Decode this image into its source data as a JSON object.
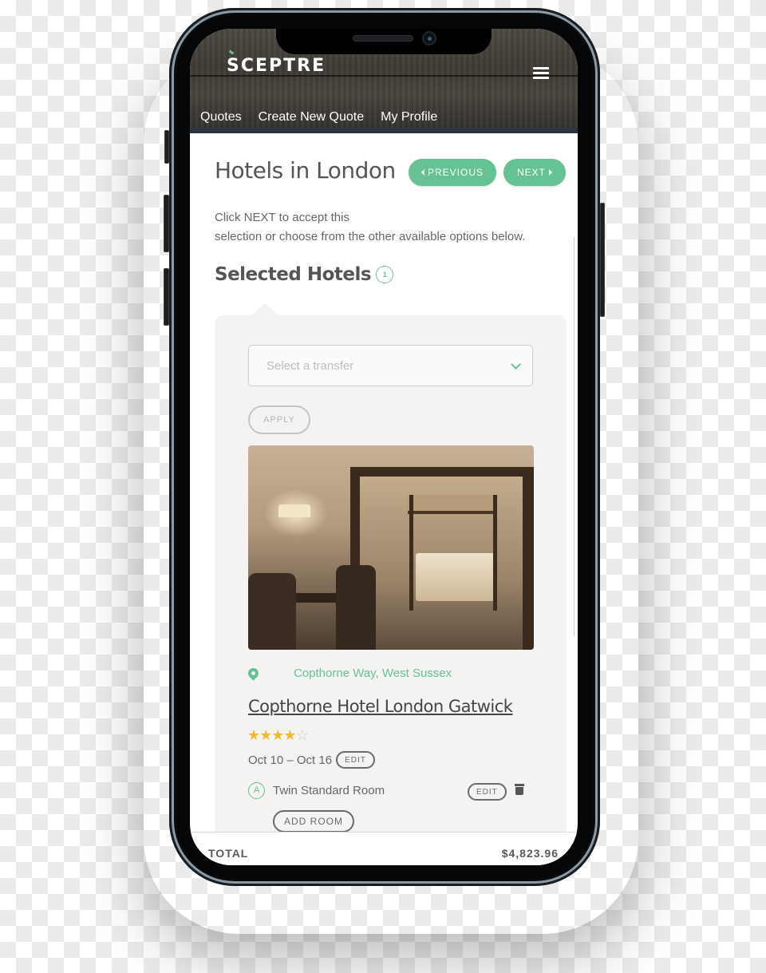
{
  "app": {
    "logo": "SCEPTRE",
    "nav": [
      "Quotes",
      "Create New Quote",
      "My Profile"
    ]
  },
  "page": {
    "title": "Hotels in London",
    "previous_label": "PREVIOUS",
    "next_label": "NEXT",
    "intro_line1": "Click NEXT to accept this",
    "intro_line2": "selection or choose from the other available options below.",
    "selected_title": "Selected Hotels",
    "selected_count": "1"
  },
  "transfer": {
    "placeholder": "Select a transfer",
    "apply_label": "APPLY"
  },
  "hotel": {
    "image_alt": "Hotel room with four-poster bed",
    "location": "Copthorne Way, West Sussex",
    "name": "Copthorne Hotel London Gatwick",
    "rating": 4,
    "rating_max": 5,
    "dates": "Oct 10 – Oct 16",
    "edit_label": "EDIT",
    "rooms": [
      {
        "badge": "A",
        "name": "Twin Standard Room",
        "edit_label": "EDIT"
      }
    ],
    "add_room_label": "ADD ROOM"
  },
  "footer": {
    "total_label": "TOTAL",
    "total_value": "$4,823.96"
  },
  "colors": {
    "accent": "#66c195",
    "star": "#f3b92c",
    "nav_bar": "#2b3543"
  }
}
